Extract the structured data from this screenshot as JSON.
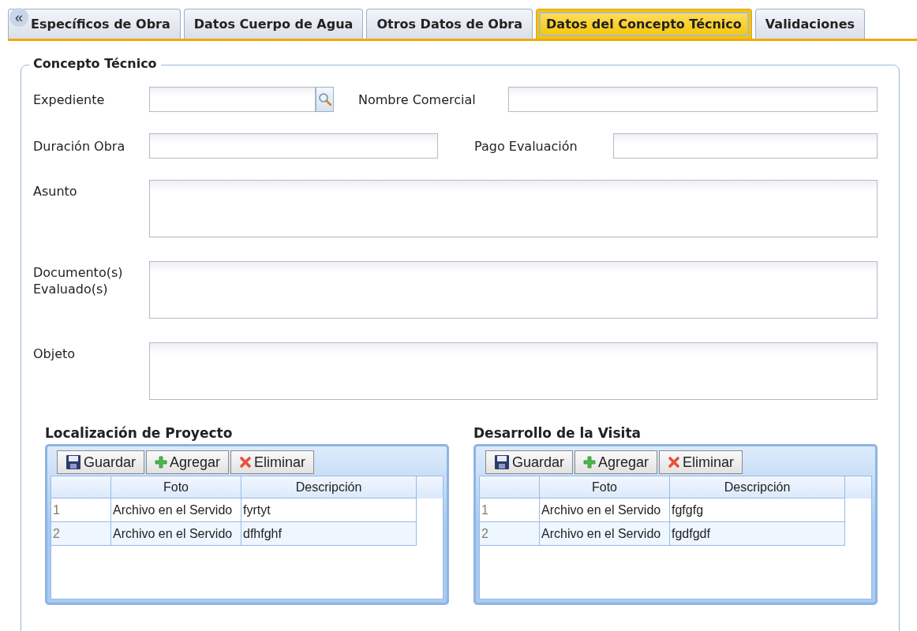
{
  "tab_scroll": "«",
  "tabs": [
    {
      "label": "Específicos de Obra",
      "selected": false
    },
    {
      "label": "Datos Cuerpo de Agua",
      "selected": false
    },
    {
      "label": "Otros Datos de Obra",
      "selected": false
    },
    {
      "label": "Datos del Concepto Técnico",
      "selected": true
    },
    {
      "label": "Validaciones",
      "selected": false
    }
  ],
  "form": {
    "legend": "Concepto Técnico",
    "expediente": {
      "label": "Expediente"
    },
    "nombre_comercial": {
      "label": "Nombre Comercial"
    },
    "duracion_obra": {
      "label": "Duración Obra"
    },
    "pago_evaluacion": {
      "label": "Pago Evaluación"
    },
    "text_areas": [
      {
        "label": "Asunto"
      },
      {
        "label": "Documento(s) Evaluado(s)"
      },
      {
        "label": "Objeto"
      }
    ]
  },
  "grids": [
    {
      "title": "Localización de Proyecto",
      "toolbar": [
        {
          "kind": "save",
          "label": "Guardar"
        },
        {
          "kind": "add",
          "label": "Agregar"
        },
        {
          "kind": "delete",
          "label": "Eliminar"
        }
      ],
      "columns": [
        "Foto",
        "Descripción"
      ],
      "rows": [
        {
          "number": "1",
          "cells": [
            "Archivo en el Servido",
            "fyrtyt"
          ]
        },
        {
          "number": "2",
          "cells": [
            "Archivo en el Servido",
            "dfhfghf"
          ]
        }
      ]
    },
    {
      "title": "Desarrollo de la Visita",
      "toolbar": [
        {
          "kind": "save",
          "label": "Guardar"
        },
        {
          "kind": "add",
          "label": "Agregar"
        },
        {
          "kind": "delete",
          "label": "Eliminar"
        }
      ],
      "columns": [
        "Foto",
        "Descripción"
      ],
      "rows": [
        {
          "number": "1",
          "cells": [
            "Archivo en el Servido",
            "fgfgfg"
          ]
        },
        {
          "number": "2",
          "cells": [
            "Archivo en el Servido",
            "fgdfgdf"
          ]
        }
      ]
    }
  ]
}
